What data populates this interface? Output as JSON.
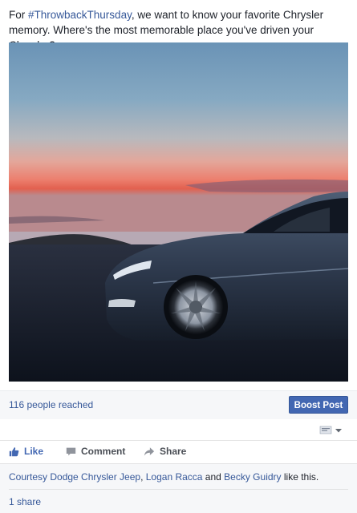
{
  "post": {
    "text_before": "For ",
    "hashtag": "#ThrowbackThursday",
    "text_after": ", we want to know your favorite Chrysler memory. Where's the most memorable place you've driven your Chrysler?"
  },
  "photo": {
    "icon": "car-sunset-photo"
  },
  "reach": {
    "reached_text": "116 people reached",
    "boost_label": "Boost Post"
  },
  "actions": {
    "like": "Like",
    "comment": "Comment",
    "share": "Share"
  },
  "social": {
    "liker1": "Courtesy Dodge Chrysler Jeep",
    "sep1": ", ",
    "liker2": "Logan Racca",
    "sep2": " and ",
    "liker3": "Becky Guidry",
    "suffix": " like this.",
    "shares": "1 share"
  },
  "colors": {
    "link": "#365899",
    "button": "#4267b2",
    "like_active": "#4267b2",
    "muted": "#4b4f56"
  }
}
